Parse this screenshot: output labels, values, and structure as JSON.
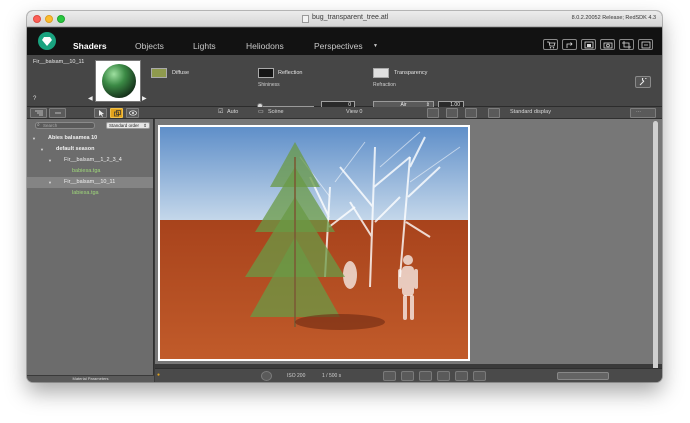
{
  "window": {
    "title": "bug_transparent_tree.atl",
    "version": "8.0.2.20052 Release; RedSDK 4.3"
  },
  "nav": {
    "tabs": [
      "Shaders",
      "Objects",
      "Lights",
      "Heliodons",
      "Perspectives"
    ],
    "active_tab": "Shaders",
    "right_icons": [
      "cart-icon",
      "share-icon",
      "window-icon",
      "camera-icon",
      "crop-icon",
      "screen-icon"
    ]
  },
  "shader": {
    "name": "Fir__balsam__10_11",
    "help": "?",
    "diffuse": {
      "label": "Diffuse",
      "color": "#8f9a4e"
    },
    "reflection": {
      "label": "Reflection",
      "color": "#151515"
    },
    "transparency": {
      "label": "Transparency",
      "color": "#e0e0e0"
    },
    "shininess": {
      "label": "Shininess",
      "value": "0"
    },
    "refraction": {
      "label": "Refraction",
      "preset": "Air",
      "value": "1.00"
    }
  },
  "toolbar": {
    "auto_label": "Auto",
    "scene_label": "Scène",
    "view_label": "View 0",
    "display_label": "Standard display"
  },
  "sidebar": {
    "search_placeholder": "Search",
    "sort_label": "Standard order",
    "tree": [
      {
        "label": "Abies balsamea 10",
        "indent": 0,
        "expanded": true
      },
      {
        "label": "default season",
        "indent": 1,
        "expanded": true
      },
      {
        "label": "Fir__balsam__1_2_3_4",
        "indent": 2,
        "expanded": true
      },
      {
        "label": "babiesa.tga",
        "indent": 3,
        "texture": true
      },
      {
        "label": "Fir__balsam__10_11",
        "indent": 2,
        "expanded": true,
        "selected": true
      },
      {
        "label": "labiesa.tga",
        "indent": 3,
        "texture": true
      }
    ],
    "footer": "Material Parameters"
  },
  "status": {
    "iso": "ISO 200",
    "shutter": "1 / 500 s"
  }
}
